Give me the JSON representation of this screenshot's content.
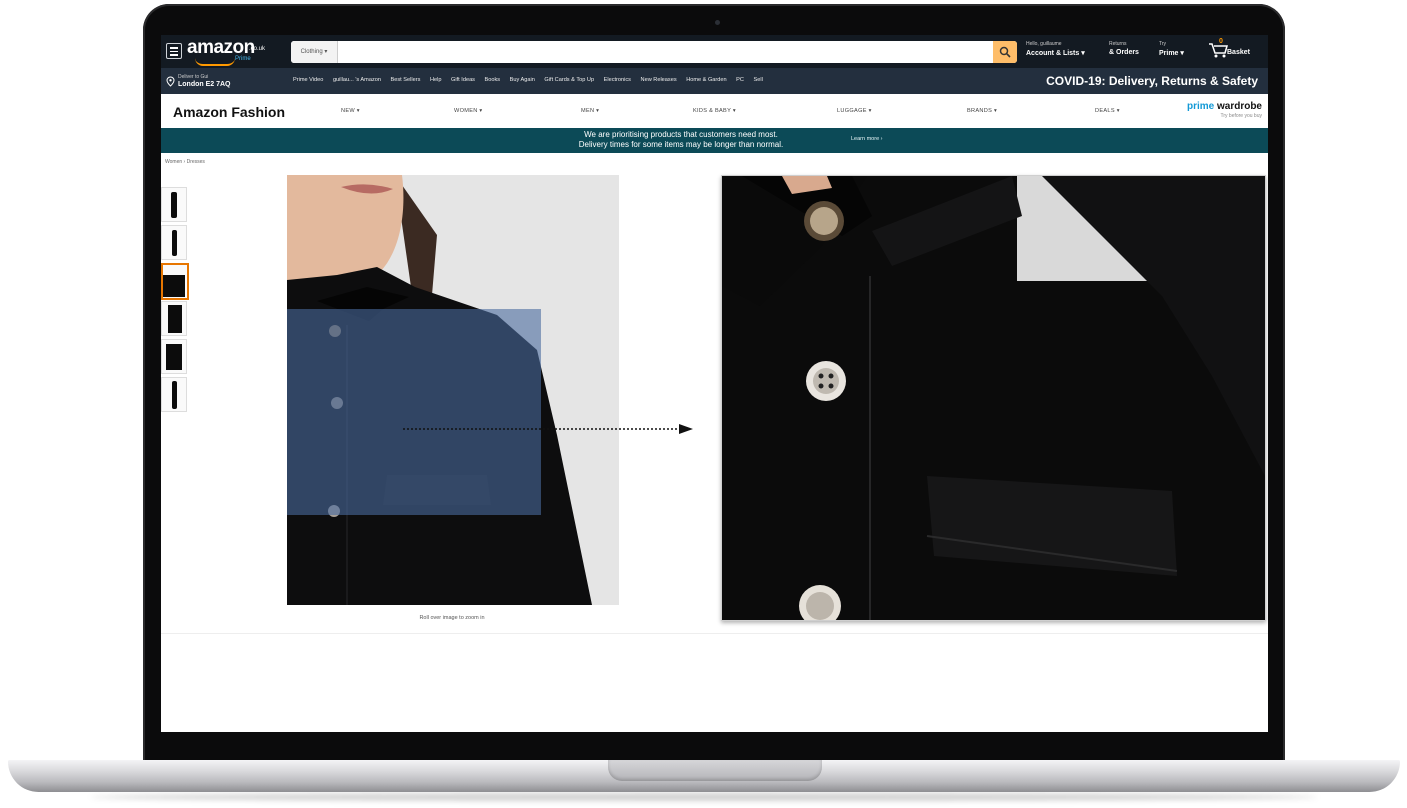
{
  "header": {
    "logo": "amazon",
    "logo_tld": ".co.uk",
    "logo_prime": "Prime",
    "search_category": "Clothing ▾",
    "search_placeholder": "",
    "account_small": "Hello, guillaume",
    "account_big": "Account & Lists ▾",
    "returns_small": "Returns",
    "returns_big": "& Orders",
    "try_small": "Try",
    "try_big": "Prime ▾",
    "basket_count": "0",
    "basket_label": "Basket"
  },
  "subnav": {
    "deliver_small": "Deliver to Gui",
    "deliver_big": "London E2 7AQ",
    "links": [
      "Prime Video",
      "guillau... 's Amazon",
      "Best Sellers",
      "Help",
      "Gift Ideas",
      "Books",
      "Buy Again",
      "Gift Cards & Top Up",
      "Electronics",
      "New Releases",
      "Home & Garden",
      "PC",
      "Sell"
    ],
    "covid": "COVID-19: Delivery, Returns & Safety"
  },
  "fashion": {
    "title": "Amazon Fashion",
    "menu": [
      "NEW ▾",
      "WOMEN ▾",
      "MEN ▾",
      "KIDS & BABY ▾",
      "LUGGAGE ▾",
      "BRANDS ▾",
      "DEALS ▾"
    ],
    "prime_word": "prime",
    "wardrobe_word": " wardrobe",
    "wardrobe_tag": "Try before you buy"
  },
  "banner": {
    "line1": "We are prioritising products that customers need most.",
    "line2": "Delivery times for some items may be longer than normal.",
    "link": "Learn more ›"
  },
  "breadcrumb": "Women › Dresses",
  "product": {
    "caption": "Roll over image to zoom in"
  },
  "colors": {
    "nav_dark": "#131a22",
    "nav_sub": "#232f3e",
    "banner": "#0c4a57",
    "accent_orange": "#ff9900",
    "search_button": "#febd69",
    "lens_overlay": "#4a6a9e"
  }
}
